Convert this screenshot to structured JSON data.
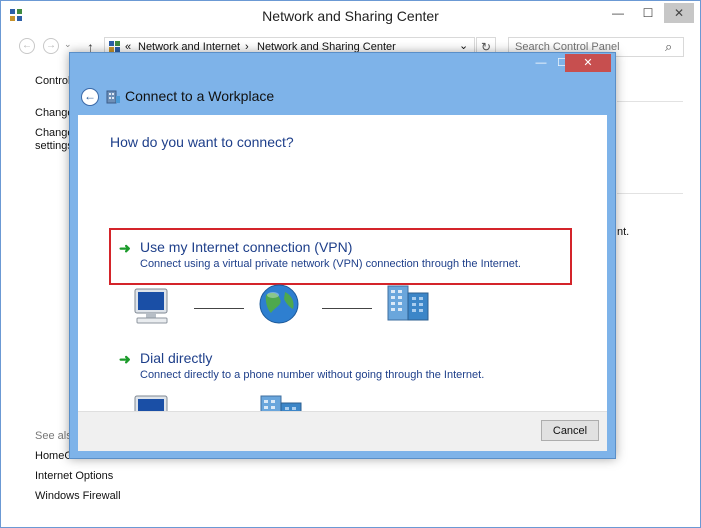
{
  "outer_window": {
    "title": "Network and Sharing Center",
    "controls": {
      "minimize": "—",
      "maximize": "☐",
      "close": "✕"
    }
  },
  "address_bar": {
    "back": "←",
    "forward": "→",
    "up": "↑",
    "overflow": "«",
    "crumbs": [
      "Network and Internet",
      "Network and Sharing Center"
    ],
    "separator": "›",
    "dropdown": "⌄",
    "refresh": "↻"
  },
  "search": {
    "placeholder": "Search Control Panel",
    "icon": "⌕"
  },
  "left_pane": {
    "control_link": "Control",
    "change_link_1": "Change",
    "change_link_2": "Change",
    "settings_link": "settings",
    "see_also": "See also",
    "homegroup": "HomeG",
    "internet_options": "Internet Options",
    "windows_firewall": "Windows Firewall"
  },
  "background_text": {
    "truncated": "nt."
  },
  "dialog": {
    "title": "Connect to a Workplace",
    "controls": {
      "minimize": "—",
      "maximize": "☐",
      "close": "✕"
    },
    "back": "←",
    "prompt": "How do you want to connect?",
    "options": [
      {
        "title": "Use my Internet connection (VPN)",
        "description": "Connect using a virtual private network (VPN) connection through the Internet.",
        "arrow": "➜"
      },
      {
        "title": "Dial directly",
        "description": "Connect directly to a phone number without going through the Internet.",
        "arrow": "➜"
      }
    ],
    "cancel_label": "Cancel"
  },
  "colors": {
    "accent_blue": "#1e3f8a",
    "dialog_frame": "#7eb3e9",
    "highlight_red": "#d4242a",
    "arrow_green": "#1c9b2b"
  }
}
